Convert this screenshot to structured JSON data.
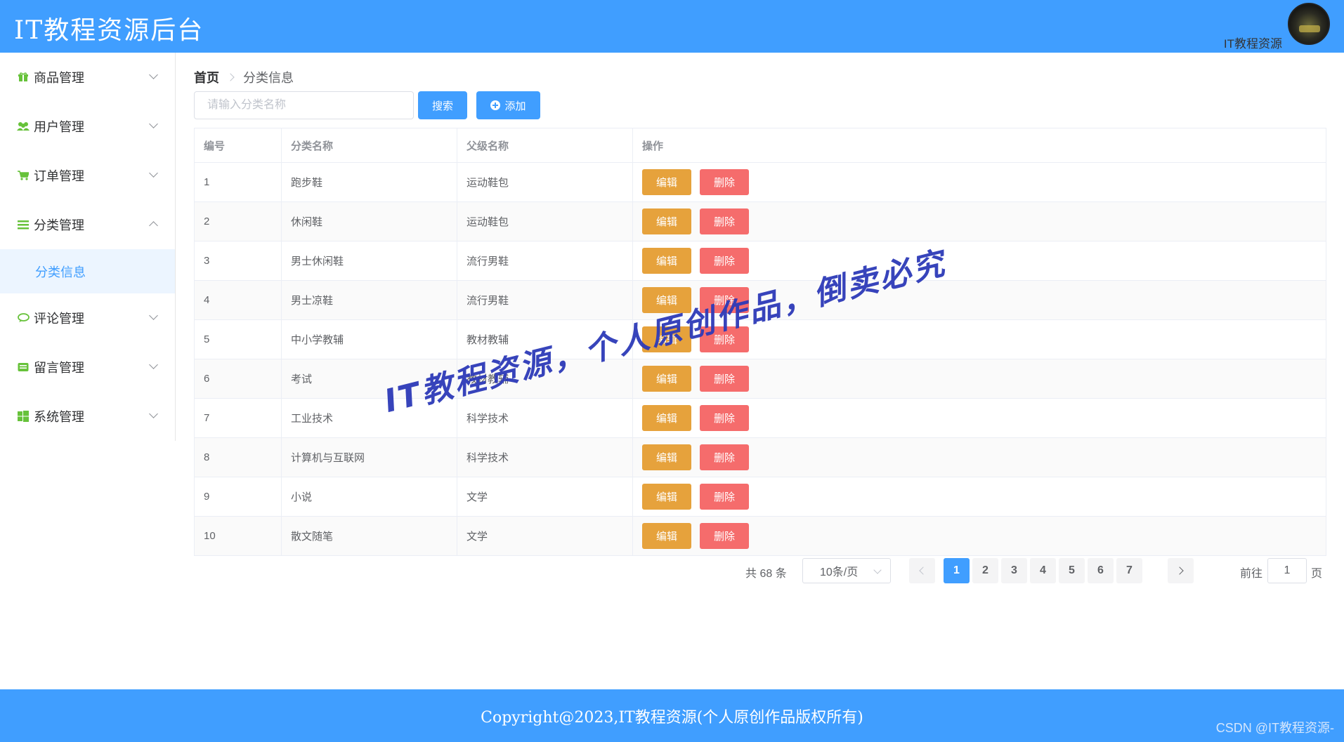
{
  "header": {
    "app_title": "IT教程资源后台",
    "user_name": "IT教程资源"
  },
  "sidebar": {
    "items": [
      {
        "label": "商品管理",
        "icon": "gift-icon",
        "expanded": false
      },
      {
        "label": "用户管理",
        "icon": "users-icon",
        "expanded": false
      },
      {
        "label": "订单管理",
        "icon": "cart-icon",
        "expanded": false
      },
      {
        "label": "分类管理",
        "icon": "list-icon",
        "expanded": true
      },
      {
        "label": "评论管理",
        "icon": "comment-icon",
        "expanded": false
      },
      {
        "label": "留言管理",
        "icon": "message-icon",
        "expanded": false
      },
      {
        "label": "系统管理",
        "icon": "windows-icon",
        "expanded": false
      }
    ],
    "submenu": {
      "label": "分类信息",
      "active": true
    }
  },
  "breadcrumb": {
    "home": "首页",
    "current": "分类信息"
  },
  "search": {
    "placeholder": "请输入分类名称",
    "value": ""
  },
  "toolbar": {
    "search_label": "搜索",
    "add_label": "添加"
  },
  "table": {
    "columns": [
      "编号",
      "分类名称",
      "父级名称",
      "操作"
    ],
    "edit_label": "编辑",
    "delete_label": "删除",
    "rows": [
      {
        "id": "1",
        "name": "跑步鞋",
        "parent": "运动鞋包"
      },
      {
        "id": "2",
        "name": "休闲鞋",
        "parent": "运动鞋包"
      },
      {
        "id": "3",
        "name": "男士休闲鞋",
        "parent": "流行男鞋"
      },
      {
        "id": "4",
        "name": "男士凉鞋",
        "parent": "流行男鞋"
      },
      {
        "id": "5",
        "name": "中小学教辅",
        "parent": "教材教辅"
      },
      {
        "id": "6",
        "name": "考试",
        "parent": "教材教辅"
      },
      {
        "id": "7",
        "name": "工业技术",
        "parent": "科学技术"
      },
      {
        "id": "8",
        "name": "计算机与互联网",
        "parent": "科学技术"
      },
      {
        "id": "9",
        "name": "小说",
        "parent": "文学"
      },
      {
        "id": "10",
        "name": "散文随笔",
        "parent": "文学"
      }
    ]
  },
  "pagination": {
    "total_text": "共 68 条",
    "page_size": "10条/页",
    "pages": [
      "1",
      "2",
      "3",
      "4",
      "5",
      "6",
      "7"
    ],
    "current_page": "1",
    "goto_label": "前往",
    "goto_value": "1",
    "page_suffix": "页"
  },
  "watermark": "IT教程资源，个人原创作品，倒卖必究",
  "footer": {
    "copyright": "Copyright@2023,IT教程资源(个人原创作品版权所有)",
    "csdn": "CSDN @IT教程资源-"
  },
  "colors": {
    "primary": "#409EFF",
    "warning": "#E6A23C",
    "danger": "#F56C6C",
    "icon_green": "#67C23A"
  }
}
